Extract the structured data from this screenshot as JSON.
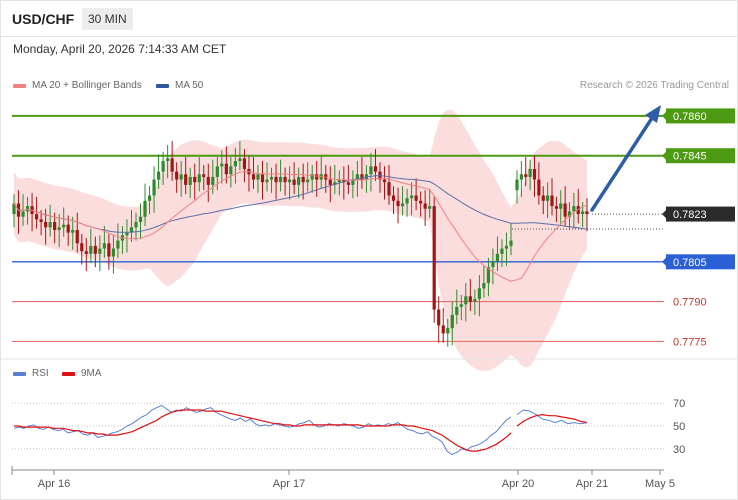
{
  "header": {
    "symbol": "USD/CHF",
    "timeframe": "30 MIN"
  },
  "datetime": "Monday, April 20, 2026 7:14:33 AM CET",
  "legend": {
    "price": [
      {
        "label": "MA 20 + Bollinger Bands",
        "color": "#f08080"
      },
      {
        "label": "MA 50",
        "color": "#2f5aa0"
      }
    ],
    "rsi": [
      {
        "label": "RSI",
        "color": "#5b7fd6"
      },
      {
        "label": "9MA",
        "color": "#e01010"
      }
    ]
  },
  "credit": "Research © 2026 Trading Central",
  "colors": {
    "bull": "#2e8b2e",
    "bear": "#a31515",
    "band_fill": "#fbd5d5",
    "ma20": "#f08080",
    "ma50": "#5a6fa8",
    "resistance": "#4c9a12",
    "support_blue": "#2a5fd6",
    "support_red": "#e06060",
    "last_price_bg": "#2b2b2b",
    "arrow": "#2e5da8"
  },
  "chart_data": [
    {
      "type": "candlestick",
      "title": "USD/CHF",
      "ylim": [
        0.7771,
        0.7866
      ],
      "x_ticks": [
        "Apr 16",
        "Apr 17",
        "Apr 20",
        "Apr 21",
        "May 5"
      ],
      "levels": [
        {
          "value": "0.7860",
          "kind": "resistance"
        },
        {
          "value": "0.7845",
          "kind": "resistance"
        },
        {
          "value": "0.7823",
          "kind": "last"
        },
        {
          "value": "0.7805",
          "kind": "support"
        },
        {
          "value": "0.7790",
          "kind": "support_minor"
        },
        {
          "value": "0.7775",
          "kind": "support_minor"
        }
      ],
      "segments": [
        {
          "closes": [
            0.7827,
            0.7822,
            0.7824,
            0.7826,
            0.7823,
            0.7821,
            0.782,
            0.7818,
            0.782,
            0.7817,
            0.7818,
            0.7819,
            0.7816,
            0.7817,
            0.7812,
            0.7809,
            0.7808,
            0.7811,
            0.7808,
            0.781,
            0.7812,
            0.7807,
            0.781,
            0.7813,
            0.7815,
            0.7816,
            0.7818,
            0.782,
            0.7822,
            0.7828,
            0.783,
            0.7836,
            0.7839,
            0.7843,
            0.7844,
            0.7839,
            0.7836,
            0.7838,
            0.7834,
            0.7837,
            0.7835,
            0.7838,
            0.7837,
            0.7834,
            0.7837,
            0.7841,
            0.7842,
            0.7838,
            0.7841,
            0.7843,
            0.7844,
            0.784,
            0.7838,
            0.7836,
            0.7838,
            0.7835,
            0.7836,
            0.7837,
            0.7835,
            0.7837,
            0.7835,
            0.7836,
            0.7834,
            0.7837,
            0.7835,
            0.7836,
            0.7838,
            0.7836,
            0.7838,
            0.7836,
            0.7834,
            0.7835,
            0.7836,
            0.7835,
            0.7834,
            0.7836,
            0.7838,
            0.7836,
            0.7838,
            0.7841,
            0.7839,
            0.7836,
            0.7835,
            0.783,
            0.7828,
            0.7826,
            0.7827,
            0.7829,
            0.783,
            0.7828,
            0.7827,
            0.7825,
            0.7826,
            0.7787,
            0.7781,
            0.7778,
            0.778,
            0.7785,
            0.7788,
            0.7789,
            0.7792,
            0.779,
            0.7791,
            0.7795,
            0.7797,
            0.7803,
            0.7805,
            0.7808,
            0.781,
            0.7811,
            0.7813
          ]
        },
        {
          "closes": [
            0.7836,
            0.7838,
            0.7837,
            0.784,
            0.7836,
            0.783,
            0.7828,
            0.783,
            0.7826,
            0.7825,
            0.7827,
            0.7822,
            0.7824,
            0.7826,
            0.7823,
            0.7824,
            0.7823
          ]
        }
      ],
      "overlays": [
        "MA 20 + Bollinger Bands",
        "MA 50"
      ]
    },
    {
      "type": "line",
      "title": "RSI",
      "ylim": [
        15,
        85
      ],
      "y_ticks": [
        70,
        50,
        30
      ],
      "series": [
        {
          "name": "RSI",
          "segments": [
            [
              48,
              49,
              48,
              50,
              51,
              48,
              47,
              49,
              47,
              46,
              47,
              44,
              45,
              46,
              43,
              42,
              44,
              40,
              41,
              42,
              44,
              45,
              47,
              50,
              52,
              55,
              58,
              60,
              64,
              66,
              68,
              65,
              62,
              64,
              63,
              66,
              64,
              62,
              63,
              65,
              66,
              62,
              60,
              58,
              56,
              55,
              57,
              54,
              56,
              52,
              50,
              51,
              50,
              52,
              51,
              50,
              49,
              50,
              52,
              53,
              55,
              51,
              49,
              50,
              52,
              51,
              50,
              52,
              51,
              50,
              48,
              49,
              52,
              50,
              51,
              50,
              52,
              51,
              53,
              50,
              47,
              46,
              44,
              43,
              45,
              41,
              39,
              36,
              28,
              25,
              27,
              30,
              29,
              32,
              33,
              35,
              38,
              42,
              45,
              50,
              55,
              58
            ],
            [
              60,
              64,
              63,
              60,
              56,
              55,
              53,
              55,
              52,
              53,
              52,
              53
            ]
          ]
        },
        {
          "name": "9MA",
          "segments": [
            [
              50,
              50,
              49,
              49,
              49,
              49,
              49,
              49,
              48,
              48,
              48,
              47,
              46,
              46,
              45,
              44,
              44,
              43,
              43,
              42,
              42,
              42,
              43,
              44,
              45,
              47,
              49,
              51,
              53,
              55,
              58,
              60,
              62,
              63,
              64,
              64,
              64,
              64,
              64,
              63,
              63,
              63,
              63,
              62,
              61,
              60,
              59,
              58,
              57,
              56,
              55,
              54,
              53,
              52,
              52,
              51,
              51,
              50,
              50,
              51,
              51,
              51,
              51,
              51,
              51,
              51,
              51,
              51,
              51,
              51,
              51,
              50,
              50,
              50,
              50,
              50,
              50,
              51,
              51,
              51,
              50,
              50,
              49,
              48,
              47,
              46,
              44,
              42,
              39,
              36,
              33,
              31,
              29,
              28,
              28,
              29,
              30,
              32,
              34,
              37,
              40,
              44
            ],
            [
              50,
              54,
              57,
              59,
              60,
              59,
              59,
              58,
              57,
              56,
              54,
              53
            ]
          ]
        }
      ]
    }
  ]
}
